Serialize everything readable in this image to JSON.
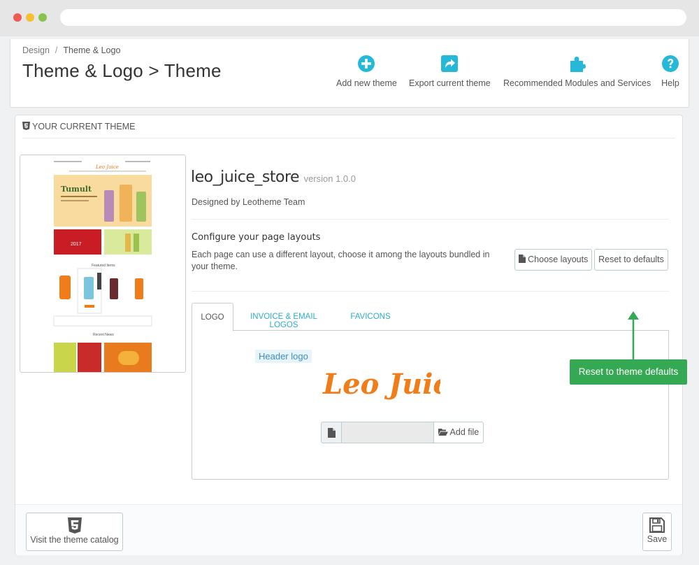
{
  "breadcrumb": {
    "parent": "Design",
    "separator": "/",
    "current": "Theme & Logo"
  },
  "page_title": "Theme & Logo > Theme",
  "toolbar": {
    "add_theme": {
      "label": "Add new theme",
      "icon": "plus-circle-icon"
    },
    "export_theme": {
      "label": "Export current theme",
      "icon": "share-icon"
    },
    "recommended": {
      "label": "Recommended Modules and Services",
      "icon": "puzzle-icon"
    },
    "help": {
      "label": "Help",
      "icon": "question-icon"
    }
  },
  "panel": {
    "heading": "YOUR CURRENT THEME",
    "theme_name": "leo_juice_store",
    "theme_version": "version 1.0.0",
    "author": "Designed by Leotheme Team",
    "configure_title": "Configure your page layouts",
    "configure_desc": "Each page can use a different layout, choose it among the layouts bundled in your theme.",
    "choose_layouts_label": "Choose layouts",
    "reset_label": "Reset to defaults"
  },
  "tabs": [
    {
      "label": "LOGO",
      "active": true
    },
    {
      "label": "INVOICE & EMAIL LOGOS",
      "active": false
    },
    {
      "label": "FAVICONS",
      "active": false
    }
  ],
  "logo_tab": {
    "header_logo_label": "Header logo",
    "logo_text": "Leo Juice",
    "add_file_label": "Add file"
  },
  "footer": {
    "catalog_label": "Visit the theme catalog",
    "save_label": "Save"
  },
  "callout": {
    "text": "Reset to theme defaults"
  },
  "colors": {
    "accent_blue": "#25b9d7",
    "link_blue": "#2eacce",
    "callout_green": "#34a853",
    "logo_orange": "#f07d1a"
  }
}
